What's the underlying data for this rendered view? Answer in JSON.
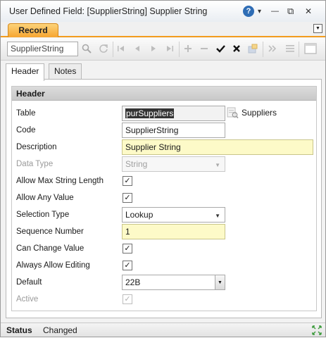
{
  "window": {
    "title": "User Defined Field: [SupplierString] Supplier String",
    "help_glyph": "?",
    "dropdown_glyph": "▾",
    "minimize_glyph": "—",
    "restore_glyph": "⧉",
    "close_glyph": "✕",
    "accent_color": "#f39c1e"
  },
  "record_tab": {
    "label": "Record"
  },
  "toolbar": {
    "search_value": "SupplierString",
    "icons": [
      "search-icon",
      "refresh-icon",
      "first-icon",
      "previous-icon",
      "next-icon",
      "last-icon",
      "add-icon",
      "remove-icon",
      "save-check-icon",
      "cancel-x-icon",
      "tag-icon",
      "more-icon",
      "list-icon",
      "window-icon"
    ]
  },
  "tabs": [
    {
      "label": "Header",
      "active": true
    },
    {
      "label": "Notes",
      "active": false
    }
  ],
  "section": {
    "title": "Header",
    "fields": {
      "table": {
        "label": "Table",
        "value": "purSuppliers",
        "lookup_label": "Suppliers"
      },
      "code": {
        "label": "Code",
        "value": "SupplierString"
      },
      "description": {
        "label": "Description",
        "value": "Supplier String"
      },
      "data_type": {
        "label": "Data Type",
        "value": "String"
      },
      "allow_max_string_length": {
        "label": "Allow Max String Length",
        "checked": true
      },
      "allow_any_value": {
        "label": "Allow Any Value",
        "checked": true
      },
      "selection_type": {
        "label": "Selection Type",
        "value": "Lookup"
      },
      "sequence_number": {
        "label": "Sequence Number",
        "value": "1"
      },
      "can_change_value": {
        "label": "Can Change Value",
        "checked": true
      },
      "always_allow_editing": {
        "label": "Always Allow Editing",
        "checked": true
      },
      "default": {
        "label": "Default",
        "value": "22B"
      },
      "active": {
        "label": "Active",
        "checked": true
      }
    },
    "check_glyph": "✓"
  },
  "status": {
    "label": "Status",
    "value": "Changed"
  }
}
